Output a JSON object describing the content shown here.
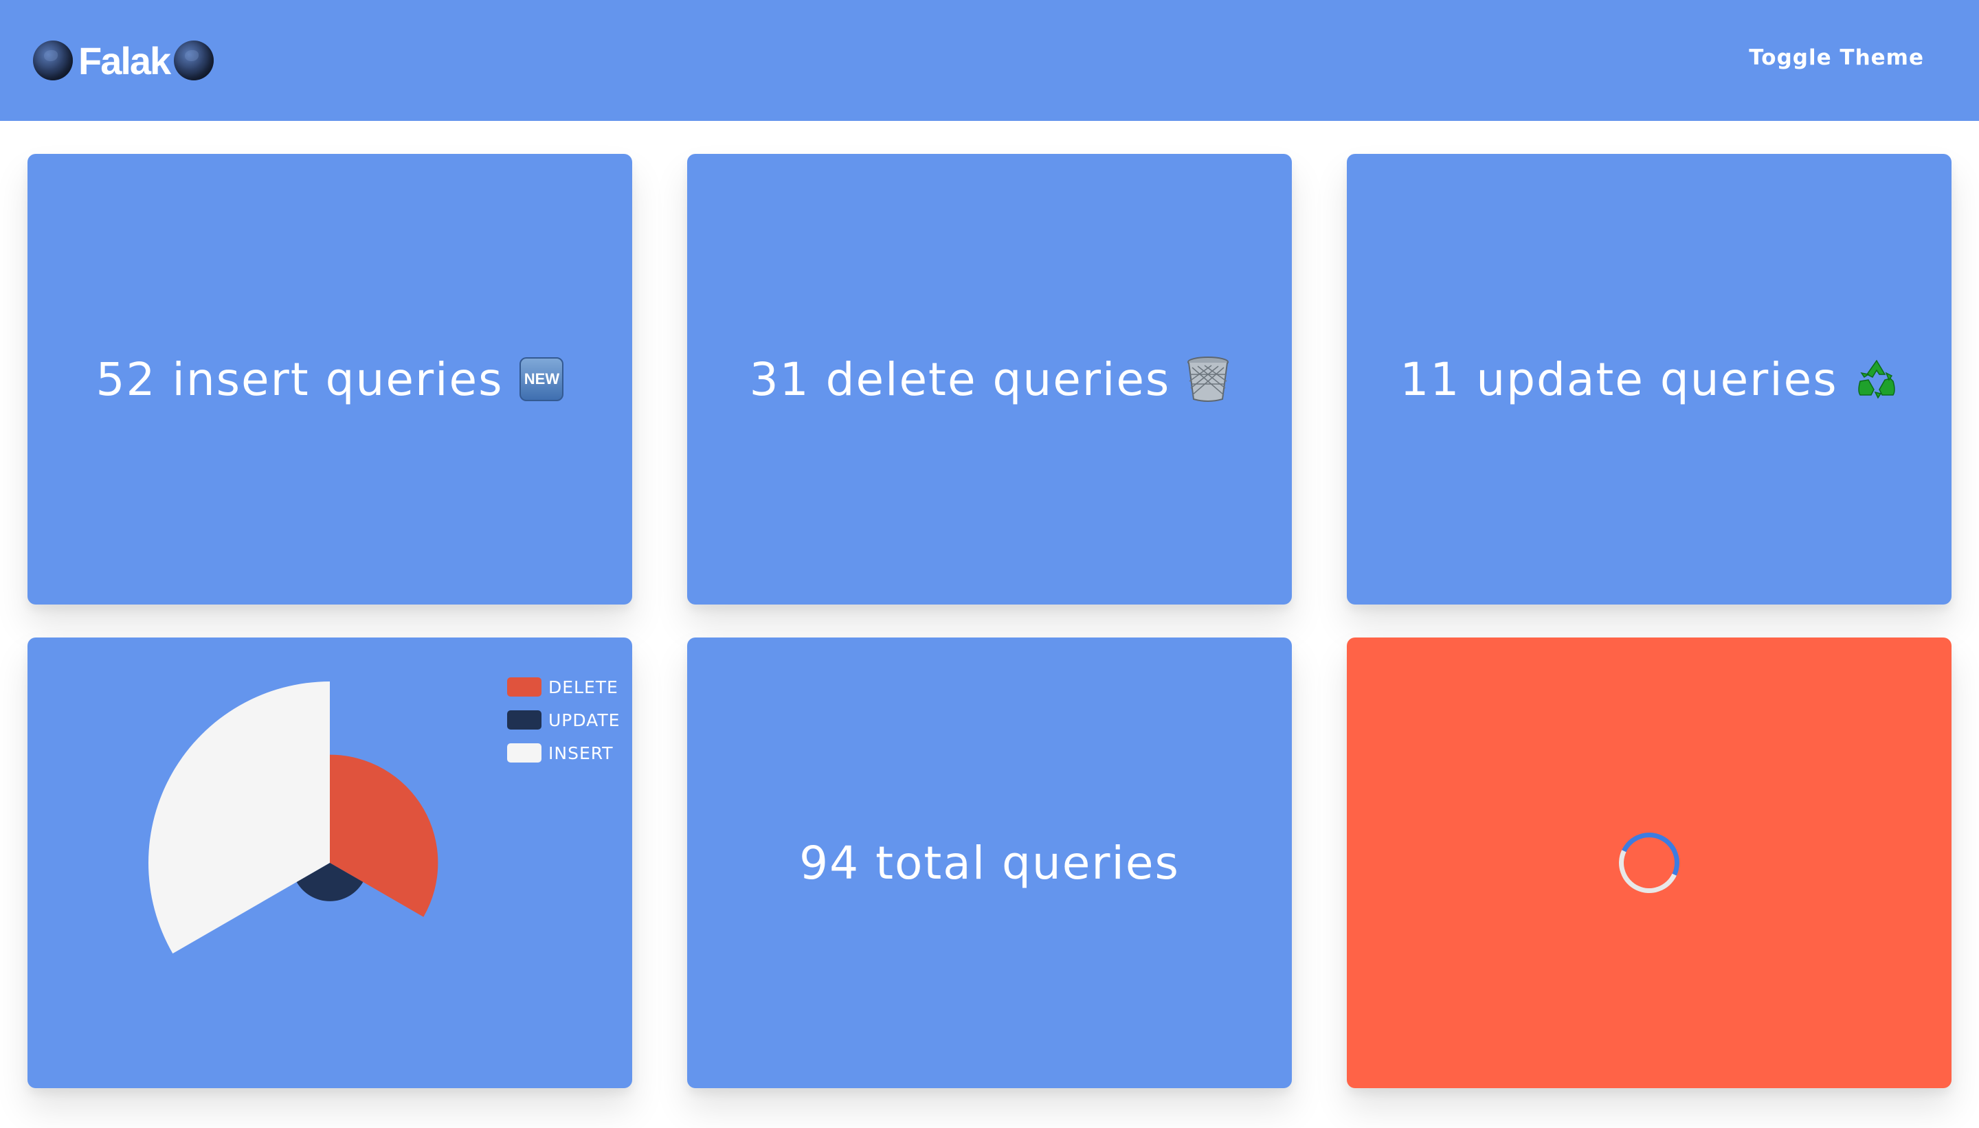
{
  "navbar": {
    "brand": "Falak",
    "brand_icon": "globe-icon",
    "toggle_label": "Toggle Theme"
  },
  "stats": {
    "insert": {
      "text": "52 insert queries",
      "icon": "new-badge-icon",
      "badge_text": "NEW"
    },
    "delete": {
      "text": "31 delete queries",
      "icon": "wastebasket-icon"
    },
    "update": {
      "text": "11 update queries",
      "icon": "recycle-icon"
    },
    "total": {
      "text": "94 total queries"
    }
  },
  "loading_card": {
    "color": "#ff6347",
    "icon": "loading-spinner-icon"
  },
  "colors": {
    "primary": "#6495ed",
    "delete": "#e0533d",
    "update": "#1f3152",
    "insert": "#f5f5f5",
    "loading": "#ff6347"
  },
  "chart_data": {
    "type": "pie",
    "variant": "polar-area",
    "legend_position": "top-right",
    "series": [
      {
        "name": "DELETE",
        "value": 31,
        "color": "#e0533d"
      },
      {
        "name": "UPDATE",
        "value": 11,
        "color": "#1f3152"
      },
      {
        "name": "INSERT",
        "value": 52,
        "color": "#f5f5f5"
      }
    ]
  }
}
